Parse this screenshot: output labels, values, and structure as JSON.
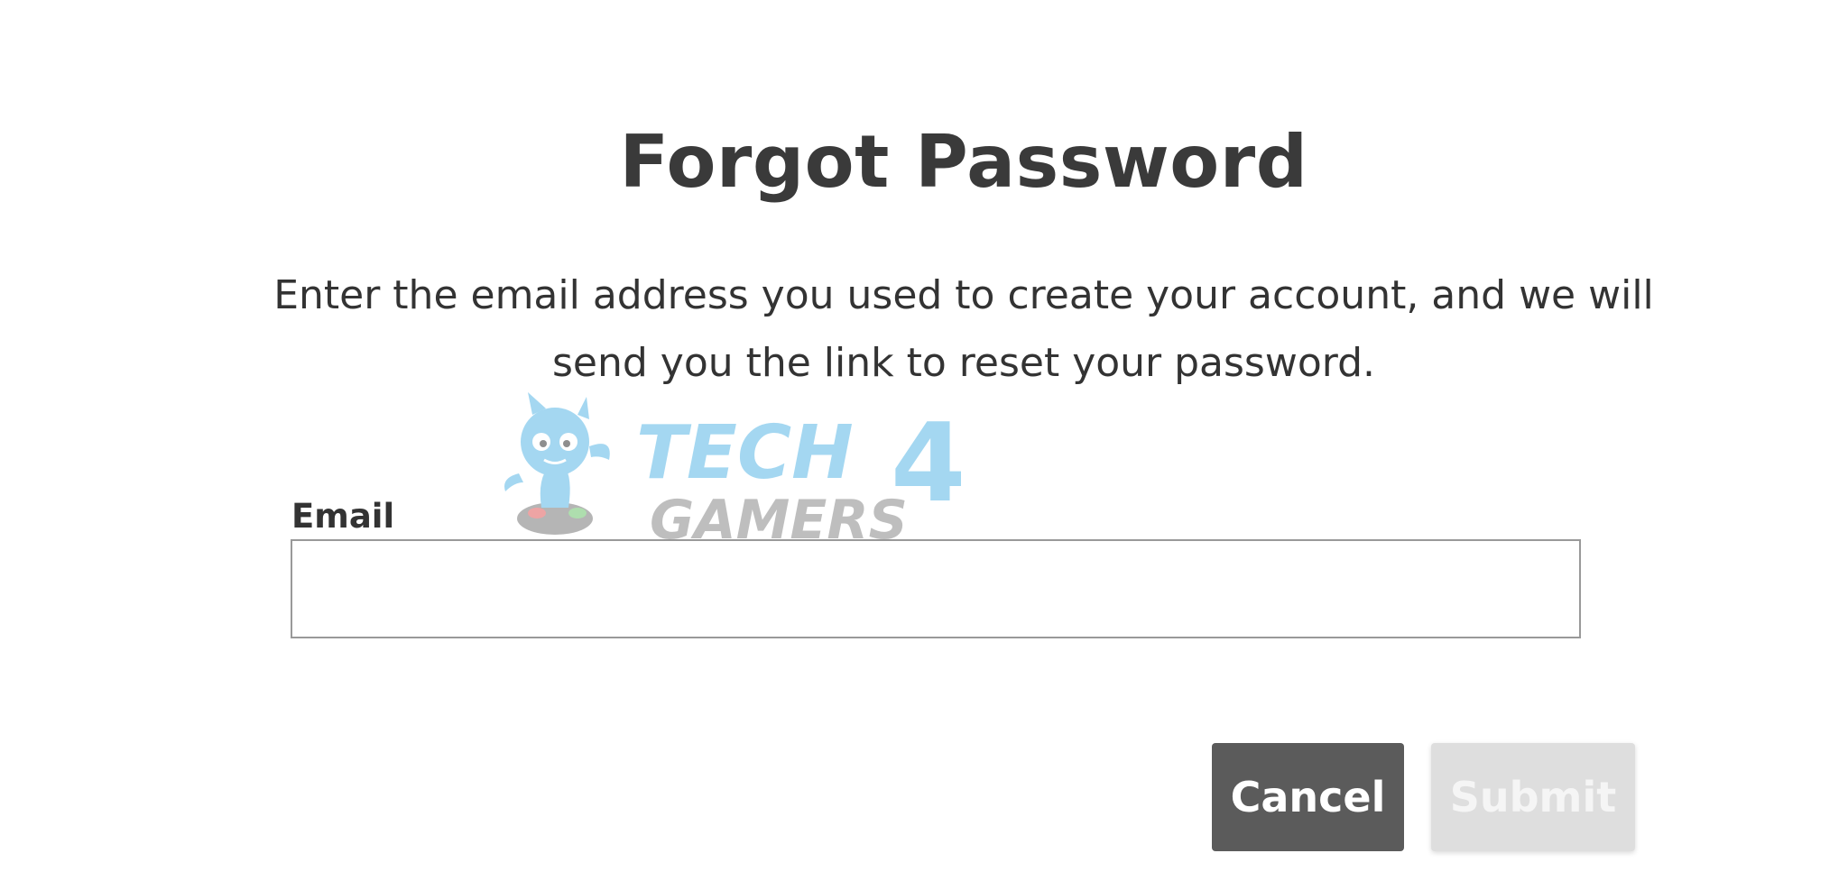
{
  "dialog": {
    "title": "Forgot Password",
    "description": "Enter the email address you used to create your account, and we will send you the link to reset your password.",
    "email_label": "Email",
    "email_value": "",
    "email_placeholder": "",
    "cancel_label": "Cancel",
    "submit_label": "Submit"
  },
  "watermark": {
    "line1": "TECH",
    "line2": "GAMERS",
    "numeral": "4",
    "colors": {
      "blue": "#5bb8e6",
      "gray": "#8a8a8a"
    }
  },
  "colors": {
    "cancel_bg": "#5b5b5b",
    "submit_bg": "#dedede",
    "text": "#333333",
    "input_border": "#999999"
  }
}
